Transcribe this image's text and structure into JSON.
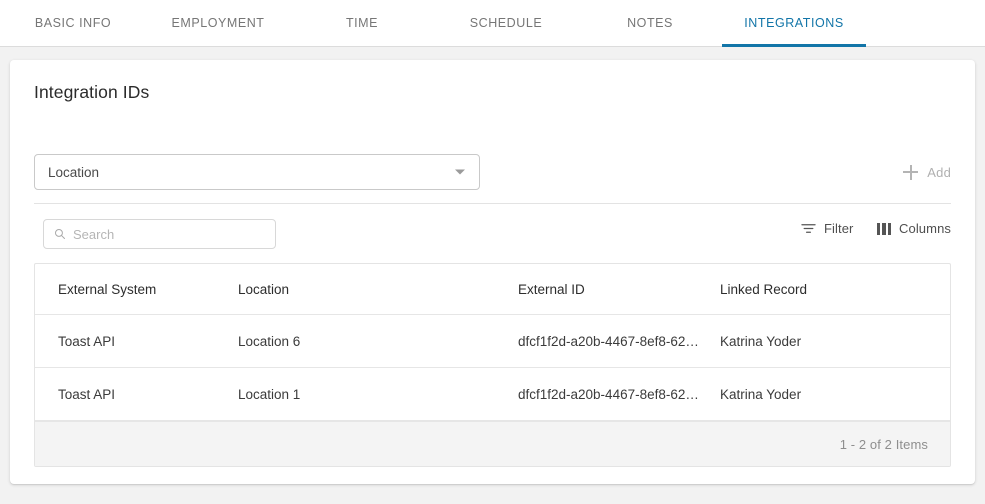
{
  "tabs": {
    "items": [
      {
        "label": "BASIC INFO",
        "active": false
      },
      {
        "label": "EMPLOYMENT",
        "active": false
      },
      {
        "label": "TIME",
        "active": false
      },
      {
        "label": "SCHEDULE",
        "active": false
      },
      {
        "label": "NOTES",
        "active": false
      },
      {
        "label": "INTEGRATIONS",
        "active": true
      }
    ],
    "active_color": "#1275a8",
    "inactive_color": "#767676"
  },
  "card": {
    "title": "Integration IDs"
  },
  "filter_select": {
    "value": "Location",
    "icon": "chevron-down-icon"
  },
  "add_button": {
    "label": "Add",
    "icon": "plus-icon"
  },
  "search": {
    "value": "",
    "placeholder": "Search",
    "icon": "search-icon"
  },
  "toolbar": {
    "filter_label": "Filter",
    "filter_icon": "filter-icon",
    "columns_label": "Columns",
    "columns_icon": "columns-icon"
  },
  "table": {
    "columns": [
      "External System",
      "Location",
      "External ID",
      "Linked Record"
    ],
    "rows": [
      {
        "external_system": "Toast API",
        "location": "Location 6",
        "external_id": "dfcf1f2d-a20b-4467-8ef8-62…",
        "linked_record": "Katrina Yoder"
      },
      {
        "external_system": "Toast API",
        "location": "Location 1",
        "external_id": "dfcf1f2d-a20b-4467-8ef8-62…",
        "linked_record": "Katrina Yoder"
      }
    ],
    "footer_text": "1 - 2 of 2 Items"
  }
}
